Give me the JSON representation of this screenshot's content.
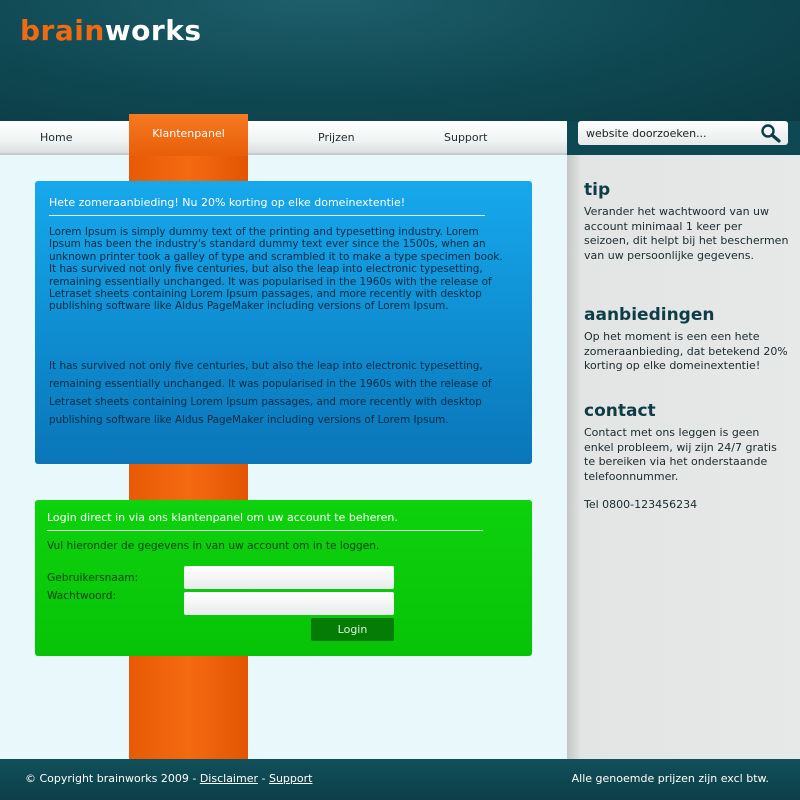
{
  "brand": {
    "part1": "brain",
    "part2": "works"
  },
  "nav": {
    "items": [
      "Home",
      "Klantenpanel",
      "Prijzen",
      "Support"
    ],
    "active": "Klantenpanel"
  },
  "search": {
    "placeholder": "website doorzoeken...",
    "value": "website doorzoeken..."
  },
  "offer_box": {
    "title": "Hete zomeraanbieding! Nu 20% korting op elke domeinextentie!",
    "paragraph1": "Lorem Ipsum is simply dummy text of the printing and typesetting industry. Lorem Ipsum has been the industry's standard dummy text ever since the 1500s, when an unknown printer took a galley of type and scrambled it to make a type specimen book. It has survived not only five centuries, but also the leap into electronic typesetting, remaining essentially unchanged. It was popularised in the 1960s with the release of Letraset sheets containing Lorem Ipsum passages, and more recently with desktop publishing software like Aldus PageMaker including versions of Lorem Ipsum.",
    "paragraph2": "It has survived not only five centuries, but also the leap into electronic typesetting, remaining essentially unchanged. It was popularised in the 1960s with the release of Letraset sheets containing Lorem Ipsum passages, and more recently with desktop publishing software like Aldus PageMaker including versions of Lorem Ipsum."
  },
  "login_box": {
    "title": "Login direct in via ons klantenpanel om uw account te beheren.",
    "intro": "Vul hieronder de gegevens in van uw account om in te loggen.",
    "username_label": "Gebruikersnaam:",
    "password_label": "Wachtwoord:",
    "username_value": "",
    "password_value": "",
    "login_label": "Login"
  },
  "sidebar": {
    "tip": {
      "title": "tip",
      "text": "Verander het wachtwoord van uw account minimaal 1 keer per seizoen, dit helpt bij het beschermen van uw persoonlijke gegevens."
    },
    "offers": {
      "title": "aanbiedingen",
      "text": "Op het moment is een een hete zomeraanbieding, dat betekend 20% korting op elke domeinextentie!"
    },
    "contact": {
      "title": "contact",
      "text": "Contact met ons leggen is geen enkel probleem, wij zijn 24/7 gratis te bereiken via het onderstaande telefoonnummer.",
      "phone": "Tel 0800-123456234"
    }
  },
  "footer": {
    "copyright": "© Copyright brainworks 2009 - ",
    "disclaimer": "Disclaimer",
    "separator": " - ",
    "support": "Support",
    "prices_note": "Alle genoemde prijzen zijn excl btw."
  },
  "colors": {
    "accent_orange": "#f26a10",
    "header_teal": "#0f4852",
    "offer_blue": "#1196d9",
    "login_green": "#0ad00a",
    "sidebar_grey": "#e6e8e8"
  }
}
